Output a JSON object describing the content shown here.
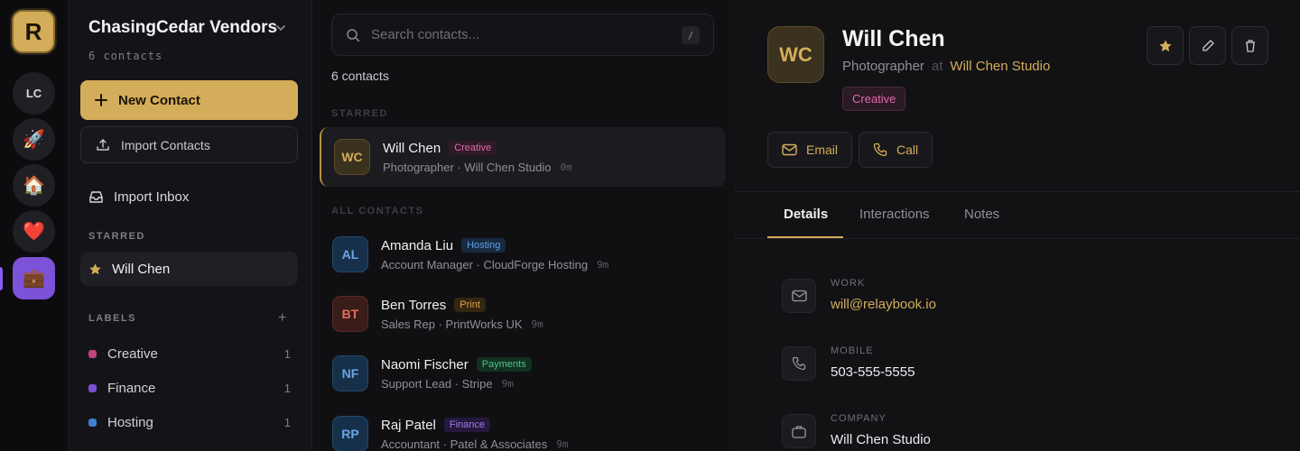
{
  "rail": {
    "logo": "R",
    "workspaces": [
      {
        "kind": "text",
        "label": "LC"
      },
      {
        "kind": "emoji",
        "label": "🚀"
      },
      {
        "kind": "emoji",
        "label": "🏠"
      },
      {
        "kind": "emoji",
        "label": "❤️"
      },
      {
        "kind": "emoji",
        "label": "💼",
        "active": true
      }
    ]
  },
  "sidebar": {
    "org_name": "ChasingCedar Vendors",
    "count": "6 contacts",
    "new_contact": "New Contact",
    "import_contacts": "Import Contacts",
    "import_inbox": "Import Inbox",
    "starred_title": "STARRED",
    "starred_item": "Will Chen",
    "labels_title": "LABELS",
    "labels": [
      {
        "name": "Creative",
        "count": "1",
        "color": "#c0437f"
      },
      {
        "name": "Finance",
        "count": "1",
        "color": "#7b4fd0"
      },
      {
        "name": "Hosting",
        "count": "1",
        "color": "#3f7fd0"
      }
    ]
  },
  "list": {
    "search_placeholder": "Search contacts...",
    "shortcut": "/",
    "count": "6 contacts",
    "starred_title": "STARRED",
    "all_title": "ALL CONTACTS",
    "starred": [
      {
        "initials": "WC",
        "name": "Will Chen",
        "tag": "Creative",
        "sub": "Photographer · Will Chen Studio",
        "time": "0m"
      }
    ],
    "contacts": [
      {
        "initials": "AL",
        "name": "Amanda Liu",
        "tag": "Hosting",
        "sub": "Account Manager · CloudForge Hosting",
        "time": "9m"
      },
      {
        "initials": "BT",
        "name": "Ben Torres",
        "tag": "Print",
        "sub": "Sales Rep · PrintWorks UK",
        "time": "9m"
      },
      {
        "initials": "NF",
        "name": "Naomi Fischer",
        "tag": "Payments",
        "sub": "Support Lead · Stripe",
        "time": "9m"
      },
      {
        "initials": "RP",
        "name": "Raj Patel",
        "tag": "Finance",
        "sub": "Accountant · Patel & Associates",
        "time": "9m"
      }
    ]
  },
  "detail": {
    "initials": "WC",
    "name": "Will Chen",
    "role": "Photographer",
    "at": "at",
    "company": "Will Chen Studio",
    "tag": "Creative",
    "email_btn": "Email",
    "call_btn": "Call",
    "tabs": [
      "Details",
      "Interactions",
      "Notes"
    ],
    "fields": [
      {
        "label": "WORK",
        "value": "will@relaybook.io",
        "icon": "mail-icon"
      },
      {
        "label": "MOBILE",
        "value": "503-555-5555",
        "icon": "phone-icon"
      },
      {
        "label": "COMPANY",
        "value": "Will Chen Studio",
        "icon": "briefcase-icon"
      }
    ]
  }
}
